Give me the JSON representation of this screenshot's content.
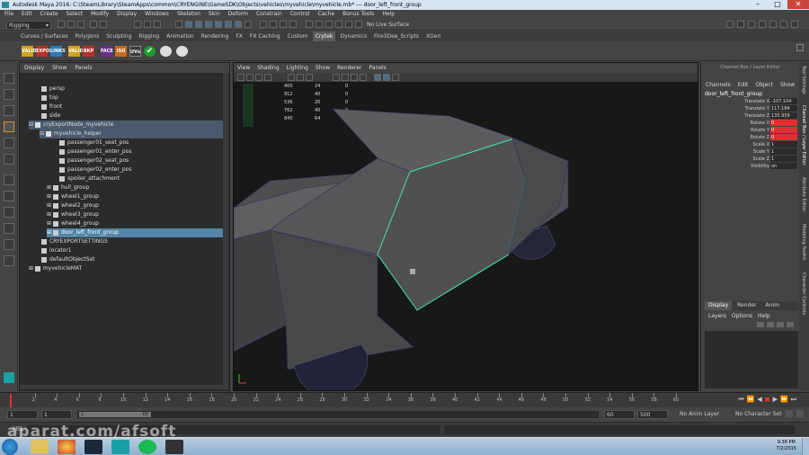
{
  "title": "Autodesk Maya 2016: C:\\SteamLibrary\\SteamApps\\common\\CRYENGINE\\GameSDK\\Objects\\vehicles\\myvehicle\\myvehicle.mb*  ---  door_left_front_group",
  "menu": [
    "File",
    "Edit",
    "Create",
    "Select",
    "Modify",
    "Display",
    "Windows",
    "Skeleton",
    "Skin",
    "Deform",
    "Constrain",
    "Control",
    "Cache",
    "Bonus Tools",
    "Help"
  ],
  "mode_select": "Rigging",
  "live_surface": "No Live Surface",
  "shelf_tabs": [
    "Curves / Surfaces",
    "Polygons",
    "Sculpting",
    "Rigging",
    "Animation",
    "Rendering",
    "FX",
    "FX Caching",
    "Custom",
    "Crytek",
    "Dynamics",
    "Fire3Dee_Scripts",
    "XGen"
  ],
  "shelf_active": "Crytek",
  "shelf_icons": [
    "VALID",
    "EXPORT",
    "LINKS",
    "VALID",
    "BKP",
    "FACE",
    "ISO",
    "UVs"
  ],
  "outliner": {
    "menu": [
      "Display",
      "Show",
      "Panels"
    ],
    "items": [
      {
        "label": "persp"
      },
      {
        "label": "top"
      },
      {
        "label": "front"
      },
      {
        "label": "side"
      },
      {
        "label": "cryExportNode_myvehicle"
      },
      {
        "label": "myvehicle_helper"
      },
      {
        "label": "passenger01_seat_pos"
      },
      {
        "label": "passenger01_enter_pos"
      },
      {
        "label": "passenger02_seat_pos"
      },
      {
        "label": "passenger02_enter_pos"
      },
      {
        "label": "spoiler_attachment"
      },
      {
        "label": "hull_group"
      },
      {
        "label": "wheel1_group"
      },
      {
        "label": "wheel2_group"
      },
      {
        "label": "wheel3_group"
      },
      {
        "label": "wheel4_group"
      },
      {
        "label": "door_left_front_group"
      },
      {
        "label": "CRYEXPORTSETTINGS"
      },
      {
        "label": "locator1"
      },
      {
        "label": "defaultObjectSet"
      },
      {
        "label": "myvehicleMAT"
      }
    ]
  },
  "viewport": {
    "menu": [
      "View",
      "Shading",
      "Lighting",
      "Show",
      "Renderer",
      "Panels"
    ],
    "hud": [
      {
        "c1": "400",
        "c2": "24",
        "c3": "0"
      },
      {
        "c1": "912",
        "c2": "40",
        "c3": "0"
      },
      {
        "c1": "536",
        "c2": "20",
        "c3": "0"
      },
      {
        "c1": "762",
        "c2": "40",
        "c3": "0"
      },
      {
        "c1": "840",
        "c2": "64",
        "c3": "0"
      }
    ]
  },
  "channel_box": {
    "header": "Channel Box / Layer Editor",
    "menu": [
      "Channels",
      "Edit",
      "Object",
      "Show"
    ],
    "object": "door_left_front_group",
    "attrs": [
      {
        "name": "Translate X",
        "value": "-107.104"
      },
      {
        "name": "Translate Y",
        "value": "117.184"
      },
      {
        "name": "Translate Z",
        "value": "135.959"
      },
      {
        "name": "Rotate X",
        "value": "0"
      },
      {
        "name": "Rotate Y",
        "value": "0"
      },
      {
        "name": "Rotate Z",
        "value": "0"
      },
      {
        "name": "Scale X",
        "value": "1"
      },
      {
        "name": "Scale Y",
        "value": "1"
      },
      {
        "name": "Scale Z",
        "value": "1"
      },
      {
        "name": "Visibility",
        "value": "on"
      }
    ],
    "layer_tabs": [
      "Display",
      "Render",
      "Anim"
    ],
    "layer_menu": [
      "Layers",
      "Options",
      "Help"
    ]
  },
  "side_tabs": [
    "Tool Settings",
    "Channel Box / Layer Editor",
    "Attribute Editor",
    "Modeling Toolkit",
    "Character Controls"
  ],
  "timeline": {
    "ticks": [
      "2",
      "4",
      "6",
      "8",
      "10",
      "12",
      "14",
      "16",
      "18",
      "20",
      "22",
      "24",
      "26",
      "28",
      "30",
      "32",
      "34",
      "36",
      "38",
      "40",
      "42",
      "44",
      "46",
      "48",
      "50",
      "52",
      "54",
      "56",
      "58",
      "60"
    ],
    "start": "1",
    "current": "1",
    "range_start": "1",
    "range_end": "60",
    "end": "60",
    "max": "500",
    "anim_layer": "No Anim Layer",
    "char_set": "No Character Set"
  },
  "cmd_label": "MEL",
  "watermark": "aparat.com/afsoft",
  "clock": {
    "time": "9:38 PM",
    "date": "7/2/2015"
  }
}
